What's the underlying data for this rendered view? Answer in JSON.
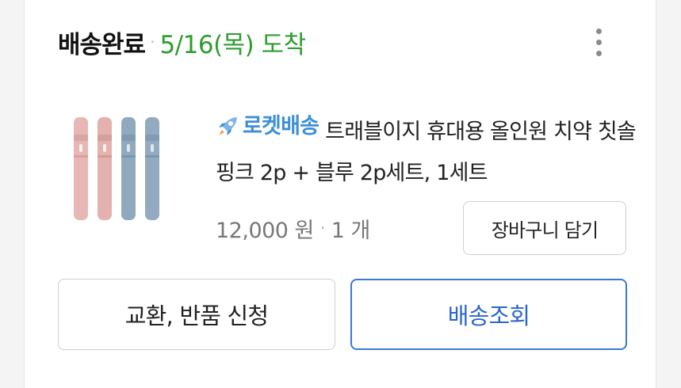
{
  "order": {
    "status": "배송완료",
    "separator": "·",
    "arrival": "5/16(목) 도착"
  },
  "more_menu": {
    "icon": "more-vertical-icon"
  },
  "product": {
    "image_icon": "toothbrush-product-image",
    "badge_label": "로켓배송",
    "badge_icon": "rocket-icon",
    "title": "트래블이지 휴대용 올인원 치약 칫솔 핑크 2p + 블루 2p세트, 1세트",
    "price": "12,000 원",
    "price_separator": "·",
    "quantity": "1 개"
  },
  "actions": {
    "add_to_cart": "장바구니 담기",
    "exchange_return": "교환, 반품 신청",
    "track_delivery": "배송조회"
  },
  "colors": {
    "arrival_green": "#2e9d2f",
    "rocket_blue": "#3d8fd6",
    "track_button_blue": "#3a78d8"
  }
}
